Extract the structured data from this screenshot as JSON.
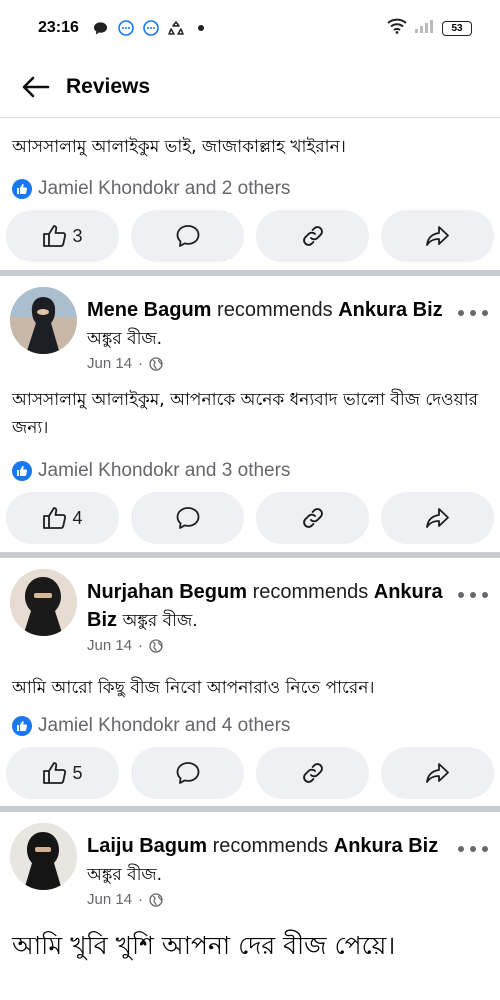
{
  "status_bar": {
    "time": "23:16",
    "battery": "53"
  },
  "header": {
    "title": "Reviews"
  },
  "posts": [
    {
      "text": "আসসালামু আলাইকুম ভাই, জাজাকাল্লাহ খাইরান।",
      "reactions": "Jamiel Khondokr and 2 others",
      "likes": "3"
    },
    {
      "name": "Mene Bagum",
      "recommends": "recommends",
      "page": "Ankura Biz",
      "page_bn": "অঙ্কুর বীজ.",
      "date": "Jun 14",
      "text": "আসসালামু আলাইকুম, আপনাকে অনেক ধন্যবাদ ভালো বীজ দেওয়ার জন্য।",
      "reactions": "Jamiel Khondokr and 3 others",
      "likes": "4"
    },
    {
      "name": "Nurjahan Begum",
      "recommends": "recommends",
      "page": "Ankura Biz",
      "page_bn": "অঙ্কুর বীজ.",
      "date": "Jun 14",
      "text": "আমি আরো কিছু বীজ নিবো আপনারাও নিতে পারেন।",
      "reactions": "Jamiel Khondokr and 4 others",
      "likes": "5"
    },
    {
      "name": "Laiju Bagum",
      "recommends": "recommends",
      "page": "Ankura Biz",
      "page_bn": "অঙ্কুর বীজ.",
      "date": "Jun 14",
      "text": "আমি খুবি খুশি আপনা দের বীজ পেয়ে।"
    }
  ],
  "colors": {
    "accent": "#1877f2",
    "button_bg": "#eef0f3",
    "divider": "#c9ccd1",
    "muted": "#65676b"
  },
  "icons": [
    "chat-bubble-icon",
    "messenger-icon",
    "messenger-icon",
    "recycle-icon",
    "wifi-icon",
    "signal-icon",
    "battery-icon",
    "back-arrow-icon",
    "like-badge-icon",
    "thumbs-up-icon",
    "comment-icon",
    "link-icon",
    "share-icon",
    "globe-icon",
    "more-icon"
  ]
}
